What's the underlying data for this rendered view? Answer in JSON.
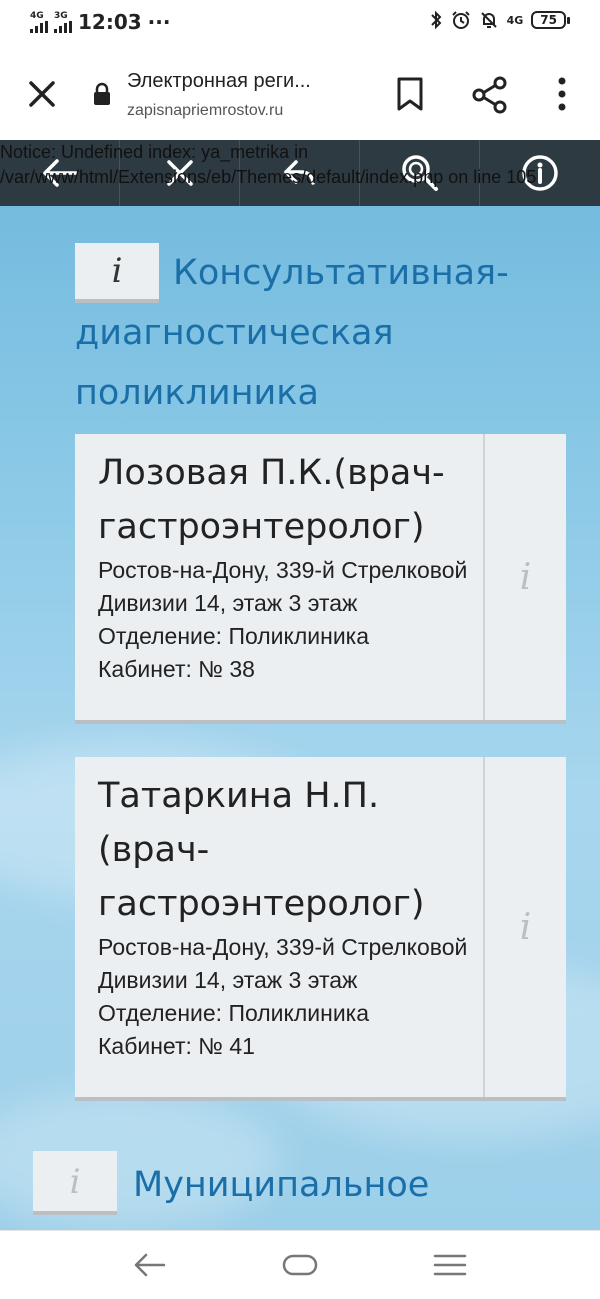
{
  "status_bar": {
    "net1": "4G",
    "net2": "3G",
    "time": "12:03",
    "dots": "···",
    "net3": "4G",
    "battery": "75"
  },
  "browser": {
    "title": "Электронная реги...",
    "url": "zapisnapriemrostov.ru"
  },
  "notice": "Notice: Undefined index: ya_metrika in /var/www/html/Extensions/eb/Themes/default/index.php on line 105",
  "section1": {
    "info_glyph": "i",
    "title_lead": "Консультативная-",
    "title_rest": "диагностическая поликлиника"
  },
  "doctors": [
    {
      "name": "Лозовая П.К.(врач-гастроэнтеролог)",
      "address": "Ростов-на-Дону, 339-й Стрелковой Дивизии 14, этаж 3 этаж",
      "department": "Отделение: Поликлиника",
      "cabinet": "Кабинет: № 38",
      "info_glyph": "i"
    },
    {
      "name": "Татаркина Н.П. (врач-гастроэнтеролог)",
      "address": "Ростов-на-Дону, 339-й Стрелковой Дивизии 14, этаж 3 этаж",
      "department": "Отделение: Поликлиника",
      "cabinet": "Кабинет: № 41",
      "info_glyph": "i"
    }
  ],
  "section2": {
    "info_glyph": "i",
    "title": "Муниципальное"
  },
  "icons": {
    "toolbar": [
      "arrow-left-icon",
      "close-icon",
      "undo-icon",
      "search-icon",
      "info-icon"
    ],
    "nav": [
      "back-icon",
      "home-icon",
      "menu-icon"
    ]
  },
  "colors": {
    "toolbar_bg": "#2e3a42",
    "title_blue": "#1b6fa8",
    "card_bg": "#eceff1"
  }
}
